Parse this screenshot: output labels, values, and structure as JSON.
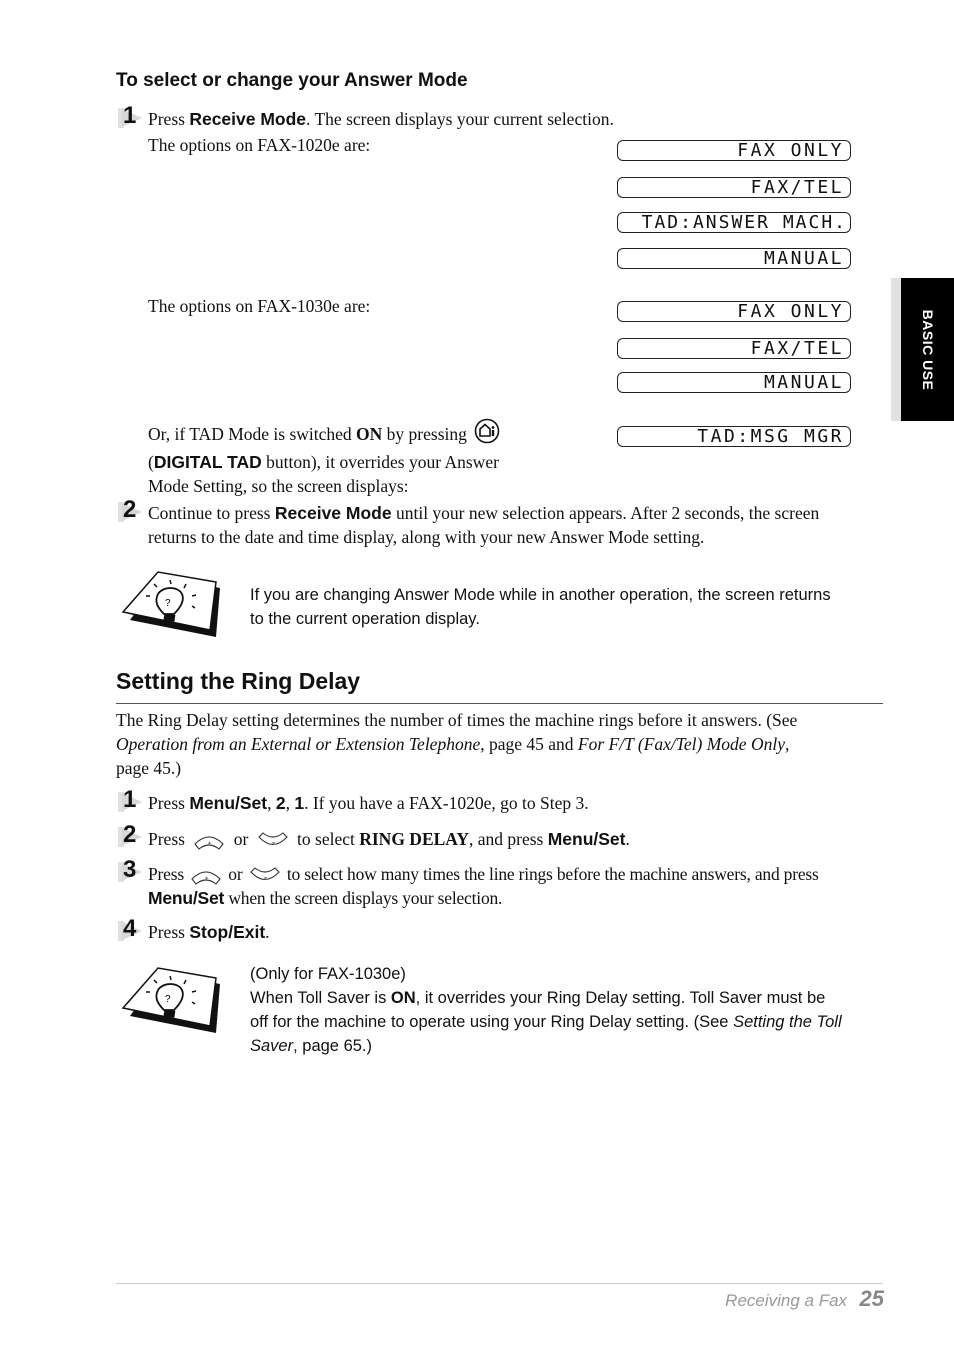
{
  "section": {
    "heading": "To select or change your Answer Mode",
    "step1": {
      "number": "1",
      "pre": "Press ",
      "key": "Receive Mode",
      "post": ". The screen displays your current selection.",
      "line2": "The options on FAX-1020e are:"
    },
    "fax1020_options": [
      "FAX ONLY",
      "FAX/TEL",
      "TAD:ANSWER MACH.",
      "MANUAL"
    ],
    "fax1030_label": "The options on FAX-1030e are:",
    "fax1030_options": [
      "FAX ONLY",
      "FAX/TEL",
      "MANUAL"
    ],
    "tad": {
      "pre": "Or, if TAD Mode is switched ",
      "on": "ON",
      "mid": " by pressing",
      "open_paren": "(",
      "button": "DIGITAL TAD",
      "post": " button), it overrides your Answer",
      "line3": "Mode Setting, so the screen displays:",
      "display": "TAD:MSG MGR",
      "icon": "digital-tad-icon"
    },
    "step2": {
      "number": "2",
      "pre": "Continue to press ",
      "key": "Receive Mode",
      "post": " until your new selection appears. After 2 seconds, the screen",
      "line2": "returns to the date and time display, along with your new Answer Mode setting."
    },
    "note1": {
      "icon": "lightbulb-note-icon",
      "line1": "If you are changing Answer Mode while in another operation, the screen returns",
      "line2": "to the current operation display."
    }
  },
  "ring_delay": {
    "heading": "Setting the Ring Delay",
    "intro": {
      "line1": "The Ring Delay setting determines the number of times the machine rings before it answers. (See",
      "ref1": "Operation from an External or Extension Telephone",
      "mid": ", page 45 and ",
      "ref2": "For F/T (Fax/Tel) Mode Only",
      "end": ",",
      "line3": "page 45.)"
    },
    "step1": {
      "number": "1",
      "pre": "Press ",
      "key": "Menu/Set",
      "sep1": ", ",
      "k2": "2",
      "sep2": ", ",
      "k3": "1",
      "post": ". If you have a FAX-1020e, go to Step 3."
    },
    "step2": {
      "number": "2",
      "pre": "Press ",
      "or": " or ",
      "mid": " to select ",
      "setting": "RING DELAY",
      "and": ", and press ",
      "key": "Menu/Set",
      "end": "."
    },
    "step3": {
      "number": "3",
      "pre": "Press ",
      "or": " or ",
      "post": " to select how many times the line rings before the machine answers, and press",
      "key": "Menu/Set",
      "line2": " when the screen displays your selection."
    },
    "step4": {
      "number": "4",
      "pre": "Press ",
      "key": "Stop/Exit",
      "end": "."
    },
    "note2": {
      "icon": "lightbulb-note-icon",
      "line1": "(Only for FAX-1030e)",
      "l2_pre": "When Toll Saver is ",
      "l2_on": "ON",
      "l2_post": ", it overrides your Ring Delay setting. Toll Saver must be",
      "l3_pre": "off for the machine to operate using your Ring Delay setting. (See ",
      "l3_ref": "Setting the Toll",
      "l4_ref": "Saver",
      "l4_post": ", page 65.)"
    }
  },
  "side_tab": {
    "label": "BASIC USE"
  },
  "footer": {
    "chapter": "Receiving a Fax",
    "page": "25"
  }
}
